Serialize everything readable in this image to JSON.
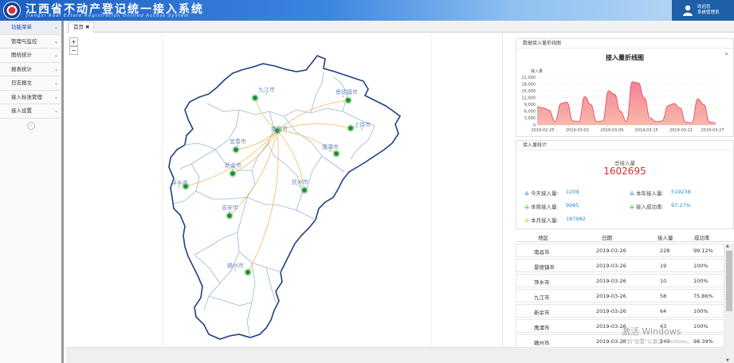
{
  "header": {
    "title": "江西省不动产登记统一接入系统",
    "subtitle": "Jiangxi Real Estate Registration Unified Access System",
    "user_line1": "欢迎您",
    "user_line2": "系统管理员"
  },
  "sidebar": {
    "items": [
      {
        "label": "功能菜单",
        "active": true
      },
      {
        "label": "管理与监控"
      },
      {
        "label": "图统统计"
      },
      {
        "label": "报表统计"
      },
      {
        "label": "日志报文"
      },
      {
        "label": "接入标准管理"
      },
      {
        "label": "接入设置"
      }
    ],
    "collapse_icon": "chevron-left-icon"
  },
  "tabs": [
    {
      "label": "首页",
      "close": "✖"
    }
  ],
  "map": {
    "zoom_in": "+",
    "zoom_out": "−",
    "cities": [
      {
        "name": "九江市"
      },
      {
        "name": "景德镇市"
      },
      {
        "name": "南昌市"
      },
      {
        "name": "上饶市"
      },
      {
        "name": "宜春市"
      },
      {
        "name": "鹰潭市"
      },
      {
        "name": "新余市"
      },
      {
        "name": "萍乡市"
      },
      {
        "name": "抚州市"
      },
      {
        "name": "吉安市"
      },
      {
        "name": "赣州市"
      }
    ]
  },
  "line_panel": {
    "header": "数据接入量折线图",
    "title": "接入量折线图",
    "y_label": "接入量",
    "expand_icon": "»"
  },
  "chart_data": {
    "type": "area",
    "title": "接入量折线图",
    "ylabel": "接入量",
    "ylim": [
      0,
      21000
    ],
    "y_ticks": [
      "0",
      "3,000",
      "6,000",
      "9,000",
      "12,000",
      "15,000",
      "18,000",
      "21,000"
    ],
    "x_ticks": [
      "2019-02-25",
      "2019-03-03",
      "2019-03-09",
      "2019-03-15",
      "2019-03-21",
      "2019-03-27"
    ],
    "series": [
      {
        "values": [
          8000,
          7500,
          6500,
          1500,
          9500,
          10000,
          1800,
          1500,
          12500,
          9000,
          1500,
          1800,
          15000,
          13500,
          6000,
          1500,
          19000,
          18500,
          12000,
          3000,
          1500,
          1800,
          8500,
          9500,
          7500,
          1200,
          1000,
          11500,
          9000,
          1200,
          1000
        ]
      }
    ],
    "fill": "#f47a8e",
    "line": "#e0495f"
  },
  "stats_panel": {
    "header": "接入量统计",
    "total_label": "总接入量",
    "total": "1602695",
    "items": [
      {
        "label": "今天接入量:",
        "value": "1209",
        "icon": "pulse-icon",
        "color": "#2b88d8"
      },
      {
        "label": "本年接入量:",
        "value": "519238",
        "icon": "pulse-icon",
        "color": "#2b88d8"
      },
      {
        "label": "本周接入量:",
        "value": "9985",
        "icon": "pulse-icon",
        "color": "#4caf50"
      },
      {
        "label": "接入成功率:",
        "value": "97.27%",
        "icon": "pulse-icon",
        "color": "#4caf50"
      },
      {
        "label": "本月接入量:",
        "value": "187982",
        "icon": "pulse-icon",
        "color": "#f0b040"
      }
    ]
  },
  "table": {
    "headers": [
      "地区",
      "日期",
      "接入量",
      "成功率"
    ],
    "rows": [
      [
        "南昌市",
        "2019-03-26",
        "228",
        "99.12%"
      ],
      [
        "景德镇市",
        "2019-03-26",
        "19",
        "100%"
      ],
      [
        "萍乡市",
        "2019-03-26",
        "10",
        "100%"
      ],
      [
        "九江市",
        "2019-03-26",
        "58",
        "75.86%"
      ],
      [
        "新余市",
        "2019-03-26",
        "64",
        "100%"
      ],
      [
        "鹰潭市",
        "2019-03-26",
        "43",
        "100%"
      ],
      [
        "赣州市",
        "2019-03-26",
        "249",
        "98.39%"
      ]
    ]
  },
  "watermark": {
    "line1": "激活 Windows",
    "line2": "转到\"设置\"以激活 Windows。"
  }
}
